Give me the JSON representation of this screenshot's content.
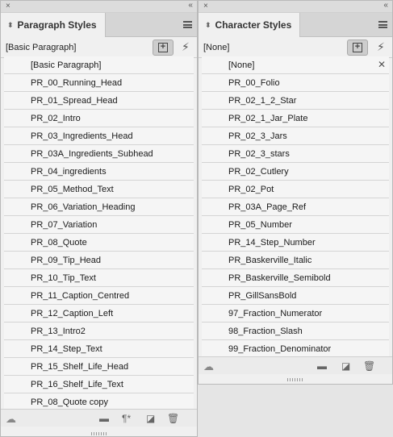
{
  "paragraph_panel": {
    "title": "Paragraph Styles",
    "current_style": "[Basic Paragraph]",
    "items": [
      "[Basic Paragraph]",
      "PR_00_Running_Head",
      "PR_01_Spread_Head",
      "PR_02_Intro",
      "PR_03_Ingredients_Head",
      "PR_03A_Ingredients_Subhead",
      "PR_04_ingredients",
      "PR_05_Method_Text",
      "PR_06_Variation_Heading",
      "PR_07_Variation",
      "PR_08_Quote",
      "PR_09_Tip_Head",
      "PR_10_Tip_Text",
      "PR_11_Caption_Centred",
      "PR_12_Caption_Left",
      "PR_13_Intro2",
      "PR_14_Step_Text",
      "PR_15_Shelf_Life_Head",
      "PR_16_Shelf_Life_Text",
      "PR_08_Quote copy"
    ]
  },
  "character_panel": {
    "title": "Character Styles",
    "current_style": "[None]",
    "items": [
      "[None]",
      "PR_00_Folio",
      "PR_02_1_2_Star",
      "PR_02_1_Jar_Plate",
      "PR_02_3_Jars",
      "PR_02_3_stars",
      "PR_02_Cutlery",
      "PR_02_Pot",
      "PR_03A_Page_Ref",
      "PR_05_Number",
      "PR_14_Step_Number",
      "PR_Baskerville_Italic",
      "PR_Baskerville_Semibold",
      "PR_GillSansBold",
      "97_Fraction_Numerator",
      "98_Fraction_Slash",
      "99_Fraction_Denominator"
    ]
  },
  "icons": {
    "close": "×",
    "collapse": "‹‹",
    "updown": "⬍",
    "bolt": "⚡",
    "cloud": "☁",
    "folder": "▬",
    "new_style": "◪",
    "clear_override": "¶*",
    "trash": "🗑",
    "clear_char": "✕"
  }
}
